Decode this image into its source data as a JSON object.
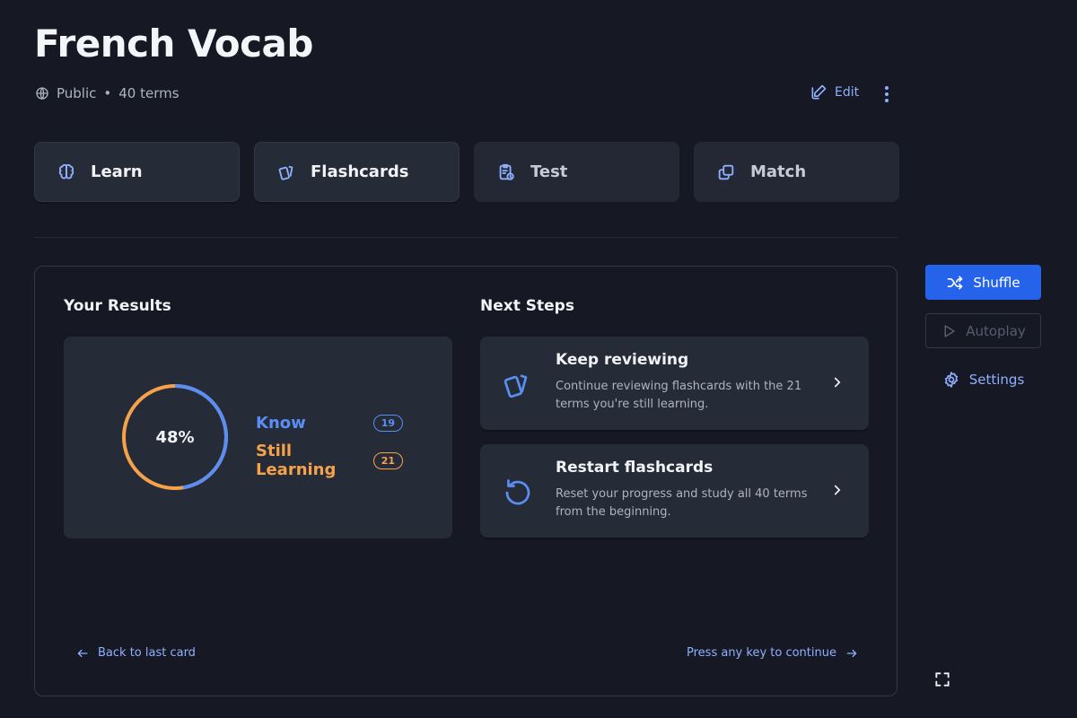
{
  "header": {
    "title": "French Vocab",
    "visibility": "Public",
    "separator": "•",
    "term_count": "40 terms",
    "edit_label": "Edit"
  },
  "modes": [
    {
      "label": "Learn",
      "icon": "brain-icon"
    },
    {
      "label": "Flashcards",
      "icon": "flashcards-icon"
    },
    {
      "label": "Test",
      "icon": "clipboard-clock-icon"
    },
    {
      "label": "Match",
      "icon": "copy-icon"
    }
  ],
  "results": {
    "heading": "Your Results",
    "percent": "48%",
    "know_label": "Know",
    "know_count": "19",
    "learning_label": "Still Learning",
    "learning_count": "21",
    "know_fraction": 0.475
  },
  "next_steps": {
    "heading": "Next Steps",
    "items": [
      {
        "title": "Keep reviewing",
        "description": "Continue reviewing flashcards with the 21 terms you're still learning."
      },
      {
        "title": "Restart flashcards",
        "description": "Reset your progress and study all 40 terms from the beginning."
      }
    ]
  },
  "footer": {
    "back_label": "Back to last card",
    "continue_label": "Press any key to continue"
  },
  "sidebar": {
    "shuffle_label": "Shuffle",
    "autoplay_label": "Autoplay",
    "settings_label": "Settings"
  },
  "colors": {
    "accent": "#2563eb",
    "know": "#5b8ef5",
    "learning": "#f6a24b",
    "background": "#161823",
    "card": "#262b38"
  }
}
